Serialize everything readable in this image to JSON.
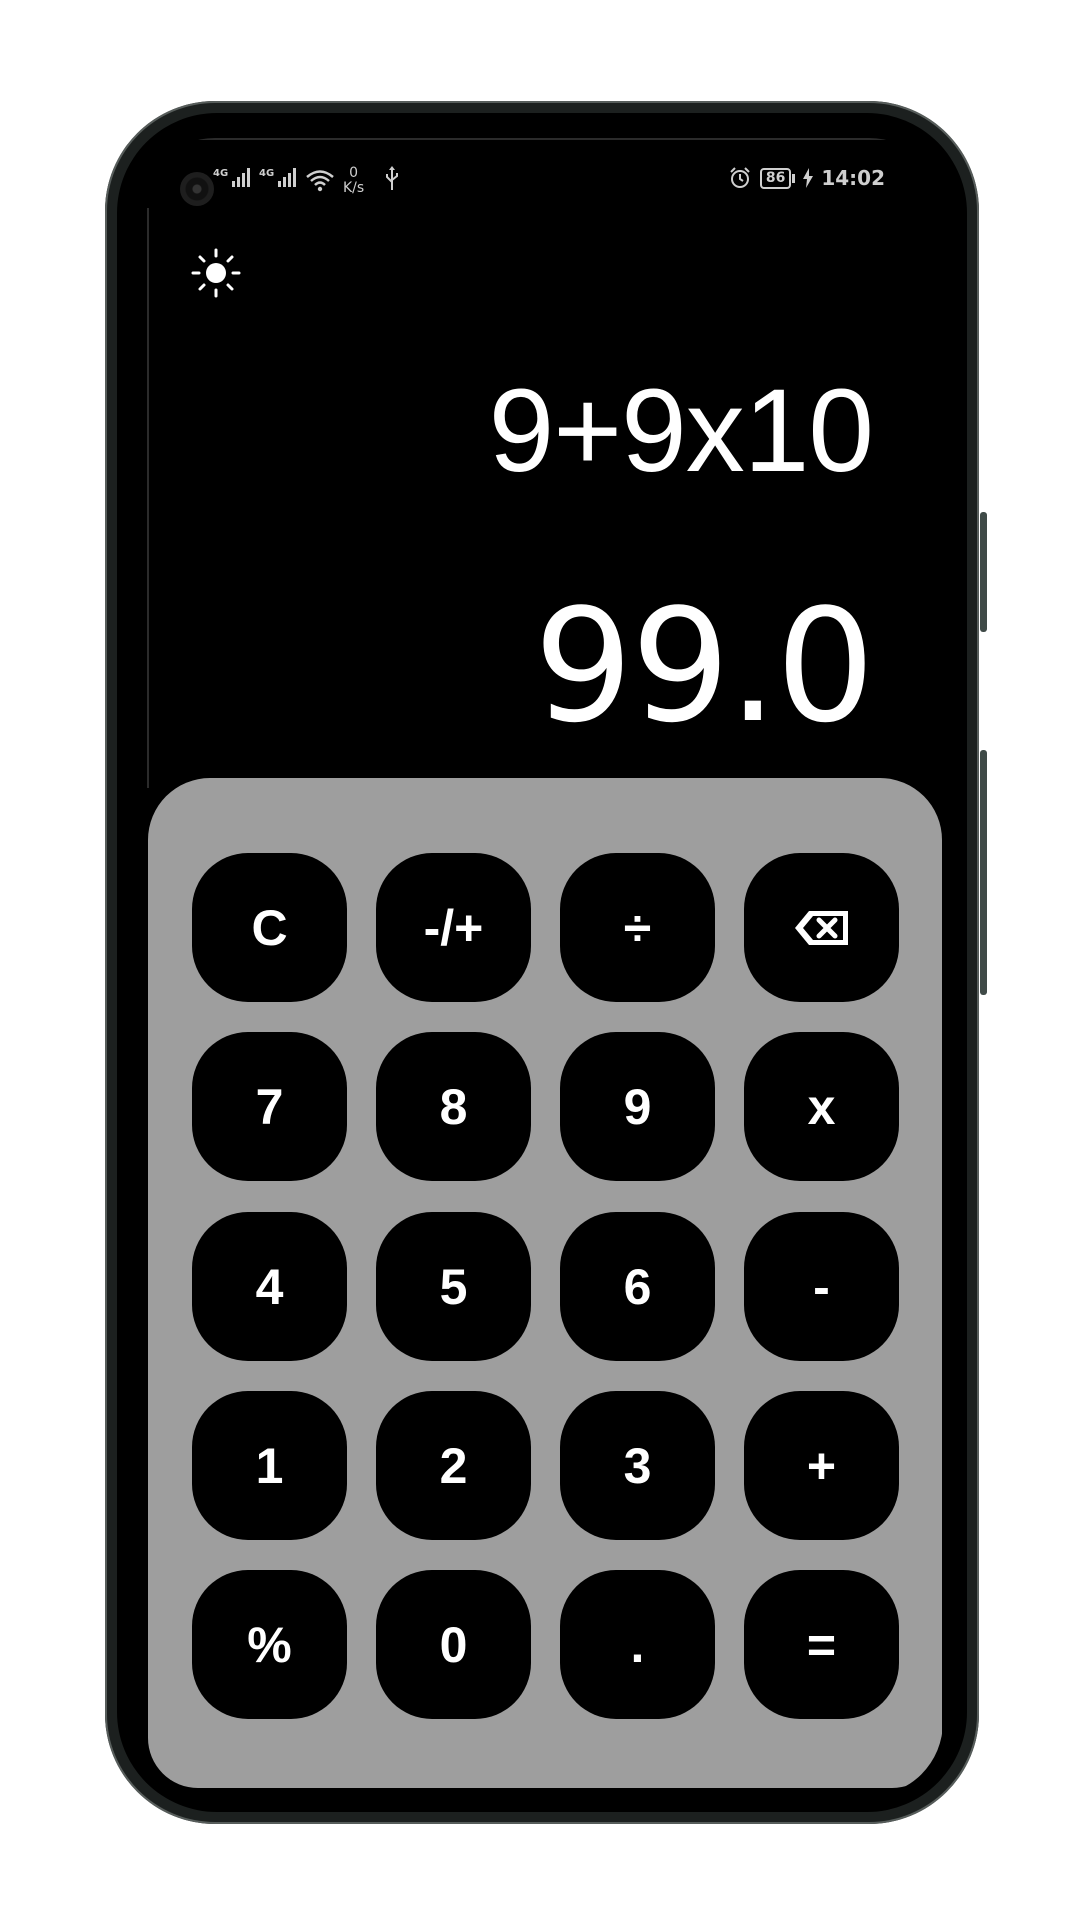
{
  "status_bar": {
    "network_1": "4G",
    "network_2": "4G",
    "speed_value": "0",
    "speed_unit": "K/s",
    "battery": "86",
    "time": "14:02",
    "icons": [
      "signal-icon",
      "wifi-icon",
      "usb-icon",
      "alarm-icon",
      "battery-icon",
      "charging-icon"
    ]
  },
  "header": {
    "theme_toggle_icon": "sun-icon"
  },
  "display": {
    "expression": "9+9x10",
    "result": "99.0"
  },
  "keypad": {
    "rows": [
      [
        "C",
        "-/+",
        "÷",
        "⌫"
      ],
      [
        "7",
        "8",
        "9",
        "x"
      ],
      [
        "4",
        "5",
        "6",
        "-"
      ],
      [
        "1",
        "2",
        "3",
        "+"
      ],
      [
        "%",
        "0",
        ".",
        "="
      ]
    ]
  },
  "colors": {
    "screen_background": "#000000",
    "keypad_background": "#9e9e9e",
    "key_background": "#000000",
    "key_text": "#ffffff",
    "display_text": "#ffffff"
  }
}
